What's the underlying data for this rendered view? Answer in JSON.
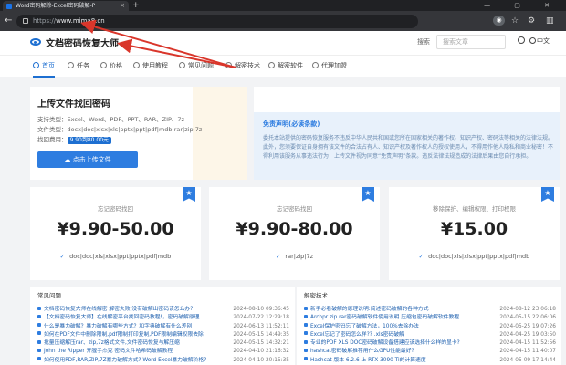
{
  "browser": {
    "tab_title": "Word密码解除-Excel密码破解-P",
    "tab_close": "×",
    "new_tab": "+",
    "window_controls": "— ▢ ✕",
    "url_prefix": "https://",
    "url_domain": "www.mima8.cn"
  },
  "header": {
    "logo_text": "文档密码恢复大师",
    "search_label": "搜索",
    "search_placeholder": "搜索文章",
    "lang": "中文"
  },
  "menu": [
    {
      "label": "首页",
      "active": true
    },
    {
      "label": "任务"
    },
    {
      "label": "价格"
    },
    {
      "label": "使用教程"
    },
    {
      "label": "常见问题"
    },
    {
      "label": "解密技术"
    },
    {
      "label": "解密软件"
    },
    {
      "label": "代理加盟"
    }
  ],
  "upload": {
    "title": "上传文件找回密码",
    "support_types": "支持类型：Excel、Word、PDF、PPT、RAR、ZIP、7z",
    "file_types": "文件类型：docx|doc|xlsx|xls|pptx|ppt|pdf|mdb|rar|zip|7z",
    "price_label": "找回费用：",
    "price_value": "9.90到80.00元",
    "button": "点击上传文件"
  },
  "disclaimer": {
    "title": "免责声明(必读条款)",
    "text": "委托本站提供的密码恢复服务不违反中华人民共和国或您所在国家相关的著作权、知识产权、密码法等相关的法律法规。此外，您须要保证自身拥有该文件的合法占有人、知识产权及著作权人的授权使用人，不得用作他人隐私和商业秘密！不得利用该服务从事违法行为！上传文件视为同意“免责声明”条款。违反法律法规造成的法律后果由您自行承担。"
  },
  "prices": [
    {
      "label": "忘记密码找回",
      "price": "¥9.90-50.00",
      "formats": "doc|doc|xls|xlsx|ppt|pptx|pdf|mdb"
    },
    {
      "label": "忘记密码找回",
      "price": "¥9.90-80.00",
      "formats": "rar|zip|7z"
    },
    {
      "label": "移除保护、编辑权限、打印权限",
      "price": "¥15.00",
      "formats": "doc|doc|xls|xlsx|ppt|pptx|pdf|mdb"
    }
  ],
  "faq": {
    "title": "常见问题",
    "items": [
      {
        "t": "文档密码恢复大师在线解密 解密失败 没有破解出密码该怎么办?",
        "d": "2024-08-10 09:36:45"
      },
      {
        "t": "【文档密码恢复大师】在线解密平台找回密码教程!，密码破解原理",
        "d": "2024-07-22 12:29:18"
      },
      {
        "t": "什么是暴力破解？暴力破解有哪些方式？和字典破解有什么差别",
        "d": "2024-06-13 11:52:11"
      },
      {
        "t": "如何在PDF文件中删除限制,pdf限制打印复制,PDF限制编辑权限去除",
        "d": "2024-05-15 14:49:35"
      },
      {
        "t": "批量压缩解压rar、zip,7z格式文件,文件密码恢复与解压缩",
        "d": "2024-05-15 14:32:21"
      },
      {
        "t": "John the Ripper 开膛手杰克 密码文件哈希码破解教程",
        "d": "2024-04-10 21:16:32"
      },
      {
        "t": "如何使用PDF,RAR,ZIP,7Z暴力破解方式? Word Excel暴力破解价格?",
        "d": "2024-04-10 20:15:35"
      }
    ]
  },
  "tech": {
    "title": "解密技术",
    "items": [
      {
        "t": "新手必看破解的原理说明:简述密码破解的各种方式",
        "d": "2024-08-12 23:06:18"
      },
      {
        "t": "Archpr zip rar密码破解软件使用说明 压缩包密码破解软件教程",
        "d": "2024-05-15 22:06:06"
      },
      {
        "t": "Excel保护密码忘了破解方法，100%去除办法",
        "d": "2024-05-25 19:07:26"
      },
      {
        "t": "Excel忘记了密码怎么样?? .xls密码破解",
        "d": "2024-04-25 19:03:50"
      },
      {
        "t": "专业的PDF XLS DOC密码破解设备搭建应该选择什么样的显卡?",
        "d": "2024-04-15 11:52:56"
      },
      {
        "t": "hashcat密码破解推荐用什么GPU性能最好?",
        "d": "2024-04-15 11:40:07"
      },
      {
        "t": "Hashcat 版本 6.2.6 上 RTX 3090 Ti的计算速度",
        "d": "2024-05-09 17:14:44"
      }
    ]
  },
  "colors": {
    "accent": "#2e7de0",
    "annotation": "#d9362b"
  }
}
